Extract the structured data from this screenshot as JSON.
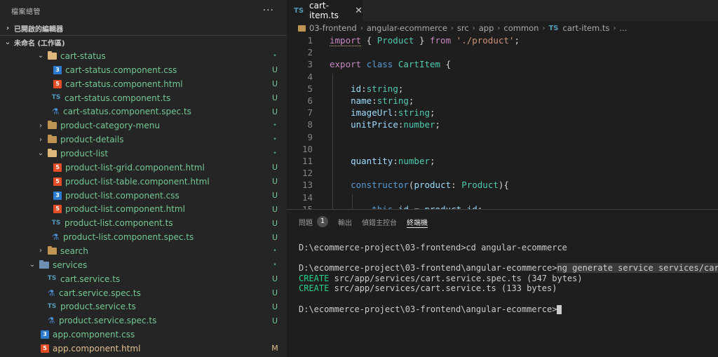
{
  "sidebar": {
    "title": "檔案總管",
    "more_icon": "ellipsis-icon",
    "open_editors_label": "已開啟的編輯器",
    "workspace_label": "未命名 (工作區)",
    "tree": [
      {
        "label": "cart-status",
        "type": "folder-open",
        "indent": 1,
        "status": "•"
      },
      {
        "label": "cart-status.component.css",
        "type": "css",
        "indent": 2,
        "status": "U"
      },
      {
        "label": "cart-status.component.html",
        "type": "html",
        "indent": 2,
        "status": "U"
      },
      {
        "label": "cart-status.component.ts",
        "type": "ts",
        "indent": 2,
        "status": "U"
      },
      {
        "label": "cart-status.component.spec.ts",
        "type": "spec",
        "indent": 2,
        "status": "U"
      },
      {
        "label": "product-category-menu",
        "type": "folder",
        "indent": 1,
        "status": "•"
      },
      {
        "label": "product-details",
        "type": "folder",
        "indent": 1,
        "status": "•"
      },
      {
        "label": "product-list",
        "type": "folder-open",
        "indent": 1,
        "status": "•"
      },
      {
        "label": "product-list-grid.component.html",
        "type": "html",
        "indent": 2,
        "status": "U"
      },
      {
        "label": "product-list-table.component.html",
        "type": "html",
        "indent": 2,
        "status": "U"
      },
      {
        "label": "product-list.component.css",
        "type": "css",
        "indent": 2,
        "status": "U"
      },
      {
        "label": "product-list.component.html",
        "type": "html",
        "indent": 2,
        "status": "U"
      },
      {
        "label": "product-list.component.ts",
        "type": "ts",
        "indent": 2,
        "status": "U"
      },
      {
        "label": "product-list.component.spec.ts",
        "type": "spec",
        "indent": 2,
        "status": "U"
      },
      {
        "label": "search",
        "type": "folder",
        "indent": 1,
        "status": "•"
      },
      {
        "label": "services",
        "type": "folder-services",
        "indent": 0,
        "status": "•"
      },
      {
        "label": "cart.service.ts",
        "type": "ts",
        "indent": 1,
        "status": "U"
      },
      {
        "label": "cart.service.spec.ts",
        "type": "spec",
        "indent": 1,
        "status": "U"
      },
      {
        "label": "product.service.ts",
        "type": "ts",
        "indent": 1,
        "status": "U"
      },
      {
        "label": "product.service.spec.ts",
        "type": "spec",
        "indent": 1,
        "status": "U"
      },
      {
        "label": "app.component.css",
        "type": "css",
        "indent": 0,
        "status": ""
      },
      {
        "label": "app.component.html",
        "type": "html",
        "indent": 0,
        "status": "M"
      }
    ]
  },
  "editor": {
    "tab_icon": "TS",
    "tab_label": "cart-item.ts",
    "breadcrumb": [
      "03-frontend",
      "angular-ecommerce",
      "src",
      "app",
      "common"
    ],
    "breadcrumb_file": "cart-item.ts",
    "breadcrumb_tail": "...",
    "lines": [
      {
        "n": "1",
        "tokens": [
          [
            "kw2",
            "import"
          ],
          [
            "p",
            " { "
          ],
          [
            "ty",
            "Product"
          ],
          [
            "p",
            " } "
          ],
          [
            "kw2",
            "from"
          ],
          [
            "p",
            " "
          ],
          [
            "str",
            "'./product'"
          ],
          [
            "p",
            ";"
          ]
        ]
      },
      {
        "n": "2",
        "tokens": []
      },
      {
        "n": "3",
        "tokens": [
          [
            "kw2",
            "export"
          ],
          [
            "p",
            " "
          ],
          [
            "kw",
            "class"
          ],
          [
            "p",
            " "
          ],
          [
            "ty",
            "CartItem"
          ],
          [
            "p",
            " {"
          ]
        ]
      },
      {
        "n": "4",
        "tokens": []
      },
      {
        "n": "5",
        "tokens": [
          [
            "p",
            "    "
          ],
          [
            "id",
            "id"
          ],
          [
            "p",
            ":"
          ],
          [
            "ty",
            "string"
          ],
          [
            "p",
            ";"
          ]
        ]
      },
      {
        "n": "6",
        "tokens": [
          [
            "p",
            "    "
          ],
          [
            "id",
            "name"
          ],
          [
            "p",
            ":"
          ],
          [
            "ty",
            "string"
          ],
          [
            "p",
            ";"
          ]
        ]
      },
      {
        "n": "7",
        "tokens": [
          [
            "p",
            "    "
          ],
          [
            "id",
            "imageUrl"
          ],
          [
            "p",
            ":"
          ],
          [
            "ty",
            "string"
          ],
          [
            "p",
            ";"
          ]
        ]
      },
      {
        "n": "8",
        "tokens": [
          [
            "p",
            "    "
          ],
          [
            "id",
            "unitPrice"
          ],
          [
            "p",
            ":"
          ],
          [
            "ty",
            "number"
          ],
          [
            "p",
            ";"
          ]
        ]
      },
      {
        "n": "9",
        "tokens": []
      },
      {
        "n": "10",
        "tokens": []
      },
      {
        "n": "11",
        "tokens": [
          [
            "p",
            "    "
          ],
          [
            "id",
            "quantity"
          ],
          [
            "p",
            ":"
          ],
          [
            "ty",
            "number"
          ],
          [
            "p",
            ";"
          ]
        ]
      },
      {
        "n": "12",
        "tokens": []
      },
      {
        "n": "13",
        "tokens": [
          [
            "p",
            "    "
          ],
          [
            "kw",
            "constructor"
          ],
          [
            "p",
            "("
          ],
          [
            "id",
            "product"
          ],
          [
            "p",
            ": "
          ],
          [
            "ty",
            "Product"
          ],
          [
            "p",
            "){"
          ]
        ]
      },
      {
        "n": "14",
        "tokens": []
      },
      {
        "n": "15",
        "tokens": [
          [
            "p",
            "        "
          ],
          [
            "kw",
            "this"
          ],
          [
            "p",
            "."
          ],
          [
            "id",
            "id"
          ],
          [
            "p",
            " = "
          ],
          [
            "id",
            "product"
          ],
          [
            "p",
            "."
          ],
          [
            "id",
            "id"
          ],
          [
            "p",
            ";"
          ]
        ]
      }
    ]
  },
  "panel": {
    "tabs": [
      "問題",
      "輸出",
      "偵錯主控台",
      "終端機"
    ],
    "problems_count": "1",
    "active_tab": "終端機",
    "terminal": [
      {
        "t": "D:\\ecommerce-project\\03-frontend>cd angular-ecommerce"
      },
      {
        "t": ""
      },
      {
        "prompt": "D:\\ecommerce-project\\03-frontend\\angular-ecommerce>",
        "cmd": "ng generate service services/cart "
      },
      {
        "create": "CREATE",
        "rest": " src/app/services/cart.service.spec.ts (347 bytes)"
      },
      {
        "create": "CREATE",
        "rest": " src/app/services/cart.service.ts (133 bytes)"
      },
      {
        "t": ""
      },
      {
        "prompt": "D:\\ecommerce-project\\03-frontend\\angular-ecommerce>",
        "cursor": true
      }
    ]
  }
}
